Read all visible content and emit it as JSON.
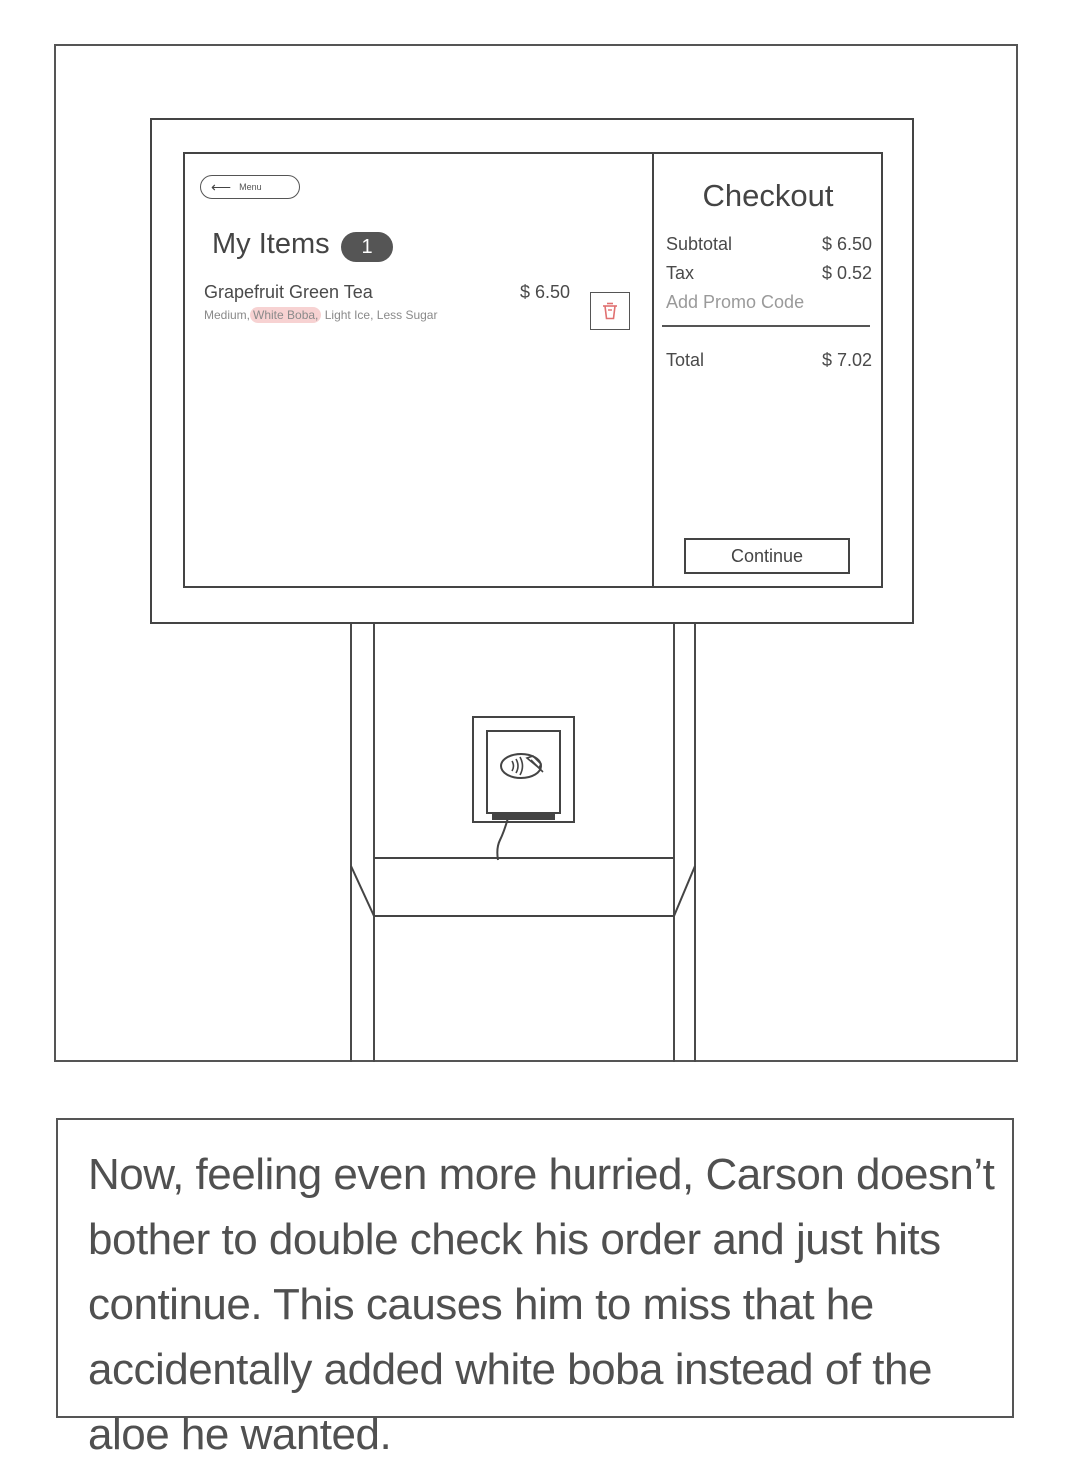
{
  "kiosk": {
    "menu_button_label": "Menu",
    "my_items_title": "My Items",
    "items_count": "1",
    "item": {
      "name": "Grapefruit Green Tea",
      "price": "$ 6.50",
      "mods_before": "Medium,",
      "mods_highlight": "White Boba,",
      "mods_after": "Light Ice, Less Sugar"
    },
    "checkout": {
      "title": "Checkout",
      "subtotal_label": "Subtotal",
      "subtotal_value": "$ 6.50",
      "tax_label": "Tax",
      "tax_value": "$ 0.52",
      "promo_label": "Add Promo Code",
      "total_label": "Total",
      "total_value": "$ 7.02",
      "continue_label": "Continue"
    },
    "highlight_color": "#f7d2d2",
    "delete_icon_color": "#e07070"
  },
  "icons": [
    "back-arrow-icon",
    "trash-icon",
    "contactless-payment-icon"
  ],
  "caption": "Now, feeling even more hurried, Carson doesn’t bother to double check his order and just hits continue. This causes him to miss that he accidentally added white boba instead of the aloe he wanted."
}
